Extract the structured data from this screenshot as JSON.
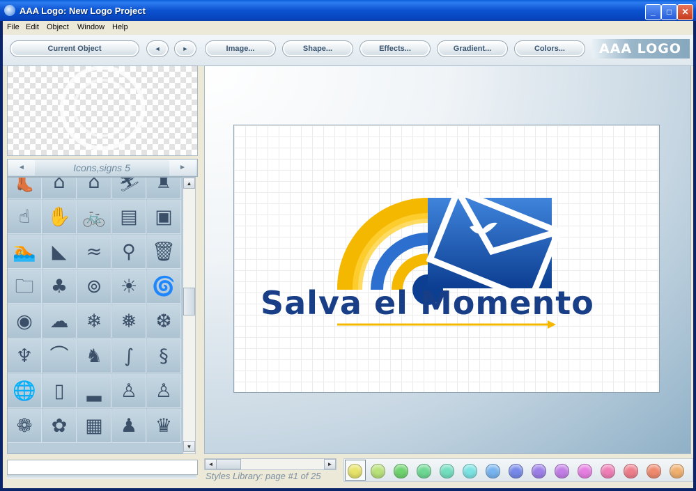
{
  "window": {
    "title": "AAA Logo: New Logo Project",
    "minimize_glyph": "_",
    "maximize_glyph": "□",
    "close_glyph": "✕"
  },
  "menu": [
    "File",
    "Edit",
    "Object",
    "Window",
    "Help"
  ],
  "toolbar": {
    "current_object": "Current Object",
    "prev_glyph": "◄",
    "next_glyph": "►",
    "image": "Image...",
    "shape": "Shape...",
    "effects": "Effects...",
    "gradient": "Gradient...",
    "colors": "Colors...",
    "brand": "AAA LOGO"
  },
  "library": {
    "title": "Icons,signs 5",
    "prev_glyph": "◄",
    "next_glyph": "►",
    "icons": [
      [
        "boot-icon",
        "barn-icon",
        "dome-icon",
        "skier-icon",
        "shop-icon"
      ],
      [
        "hand-computer-icon",
        "hand-sign-icon",
        "bicycle-icon",
        "document-icon",
        "computer-icon"
      ],
      [
        "swimmer-icon",
        "map-icon",
        "shore-icon",
        "lollipop-icon",
        "trash-bin-icon"
      ],
      [
        "folder-icon",
        "tree-icon",
        "intel-inside-icon",
        "sun-swirl-icon",
        "spiral-icon"
      ],
      [
        "dvd-icon",
        "cloud-emblem-icon",
        "snowflake-outline-icon",
        "snowflake-icon",
        "snowflake-star-icon"
      ],
      [
        "totem-bird-icon",
        "bat-icon",
        "deer-icon",
        "lizard-icon",
        "seahorse-icon"
      ],
      [
        "globe-icon",
        "phone-icon",
        "skyline-icon",
        "desk-person-icon",
        "desk-person-2-icon"
      ],
      [
        "ornament-icon",
        "round-tree-icon",
        "picture-frame-icon",
        "figure-icon",
        "face-icon"
      ]
    ],
    "glyphs": [
      [
        "👢",
        "⌂",
        "⌂",
        "⛷",
        "♜"
      ],
      [
        "☝",
        "✋",
        "🚲",
        "▤",
        "▣"
      ],
      [
        "🏊",
        "◣",
        "≈",
        "⚲",
        "🗑"
      ],
      [
        "🗀",
        "♣",
        "⊚",
        "☀",
        "🌀"
      ],
      [
        "◉",
        "☁",
        "❄",
        "❅",
        "❆"
      ],
      [
        "♆",
        "⌒",
        "♞",
        "∫",
        "§"
      ],
      [
        "🌐",
        "▯",
        "▂",
        "♙",
        "♙"
      ],
      [
        "❁",
        "✿",
        "▦",
        "♟",
        "♛"
      ]
    ]
  },
  "canvas": {
    "logo_text": "Salva el Momento",
    "accent_colors": {
      "blue": "#173e86",
      "yellow": "#f5b800",
      "light_blue": "#3f7fd6"
    }
  },
  "styles": {
    "label": "Styles Library: page #1 of 25",
    "swatch_colors": [
      "#e8e46a",
      "#b9e27a",
      "#6fd36e",
      "#6ed893",
      "#72dfbf",
      "#7be3e3",
      "#78b4f0",
      "#7689ea",
      "#9c7ee8",
      "#c27ee6",
      "#e67ee2",
      "#ef7fb6",
      "#ef7e8c",
      "#ef8a6e",
      "#f0b070"
    ]
  }
}
